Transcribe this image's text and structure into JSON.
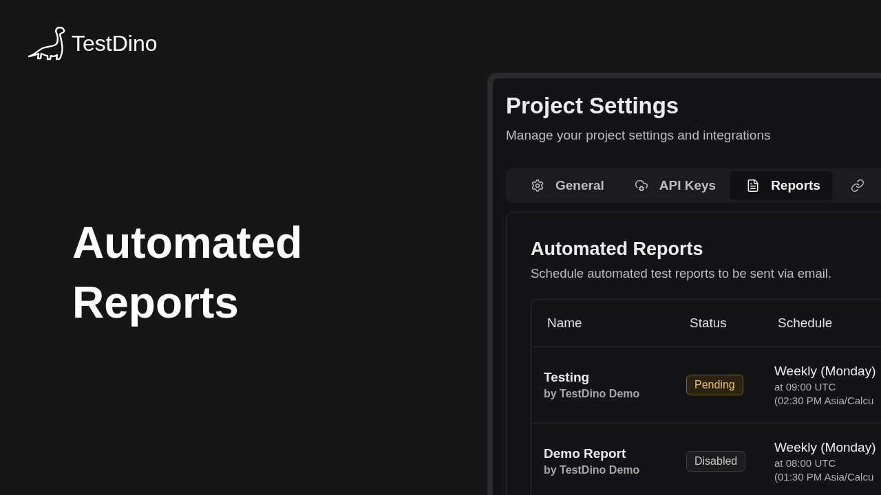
{
  "brand": {
    "name": "TestDino"
  },
  "headline": [
    "Automated",
    "Reports"
  ],
  "window": {
    "title": "Project Settings",
    "subtitle": "Manage your project settings and integrations"
  },
  "tabs": [
    {
      "label": "General",
      "selected": false
    },
    {
      "label": "API Keys",
      "selected": false
    },
    {
      "label": "Reports",
      "selected": true
    },
    {
      "selected": false
    }
  ],
  "card": {
    "title": "Automated Reports",
    "subtitle": "Schedule automated test reports to be sent via email."
  },
  "table": {
    "columns": [
      "Name",
      "Status",
      "Schedule"
    ],
    "rows": [
      {
        "name": "Testing",
        "owner": "by TestDino Demo",
        "status": "Pending",
        "kind": "pending",
        "schedule": "Weekly (Monday)",
        "time": "at 09:00 UTC",
        "local": "(02:30 PM Asia/Calcu"
      },
      {
        "name": "Demo Report",
        "owner": "by TestDino Demo",
        "status": "Disabled",
        "kind": "disabled",
        "schedule": "Weekly (Monday)",
        "time": "at 08:00 UTC",
        "local": "(01:30 PM Asia/Calcu"
      }
    ]
  }
}
